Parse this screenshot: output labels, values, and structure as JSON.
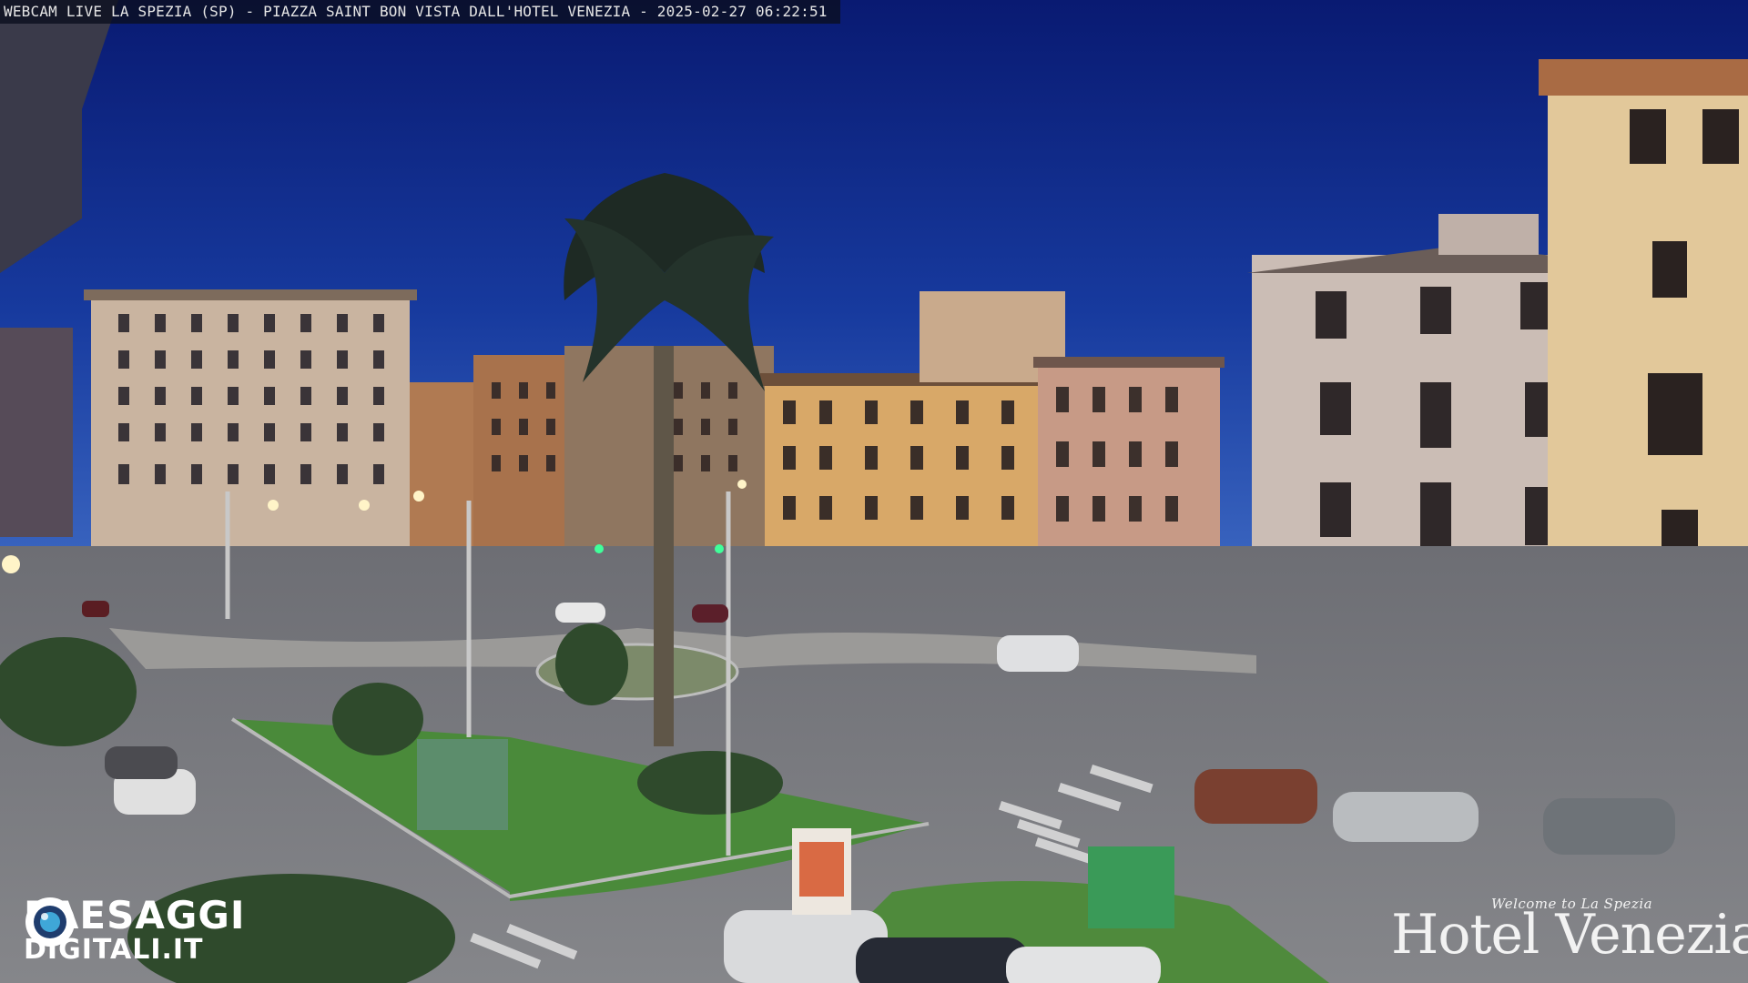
{
  "overlay": {
    "caption": "WEBCAM LIVE LA SPEZIA (SP) - PIAZZA SAINT BON VISTA DALL'HOTEL VENEZIA - 2025-02-27 06:22:51"
  },
  "watermark_left": {
    "line1": "PAESAGGI",
    "line2": "DIGITALI.IT",
    "icon": "camera-lens-icon"
  },
  "watermark_right": {
    "tagline": "Welcome to La Spezia",
    "name": "Hotel Venezia"
  },
  "colors": {
    "sky_top": "#0b1f7a",
    "sky_bottom": "#2f58b8",
    "grass": "#4a8a3a",
    "road": "#7a7a7c"
  }
}
